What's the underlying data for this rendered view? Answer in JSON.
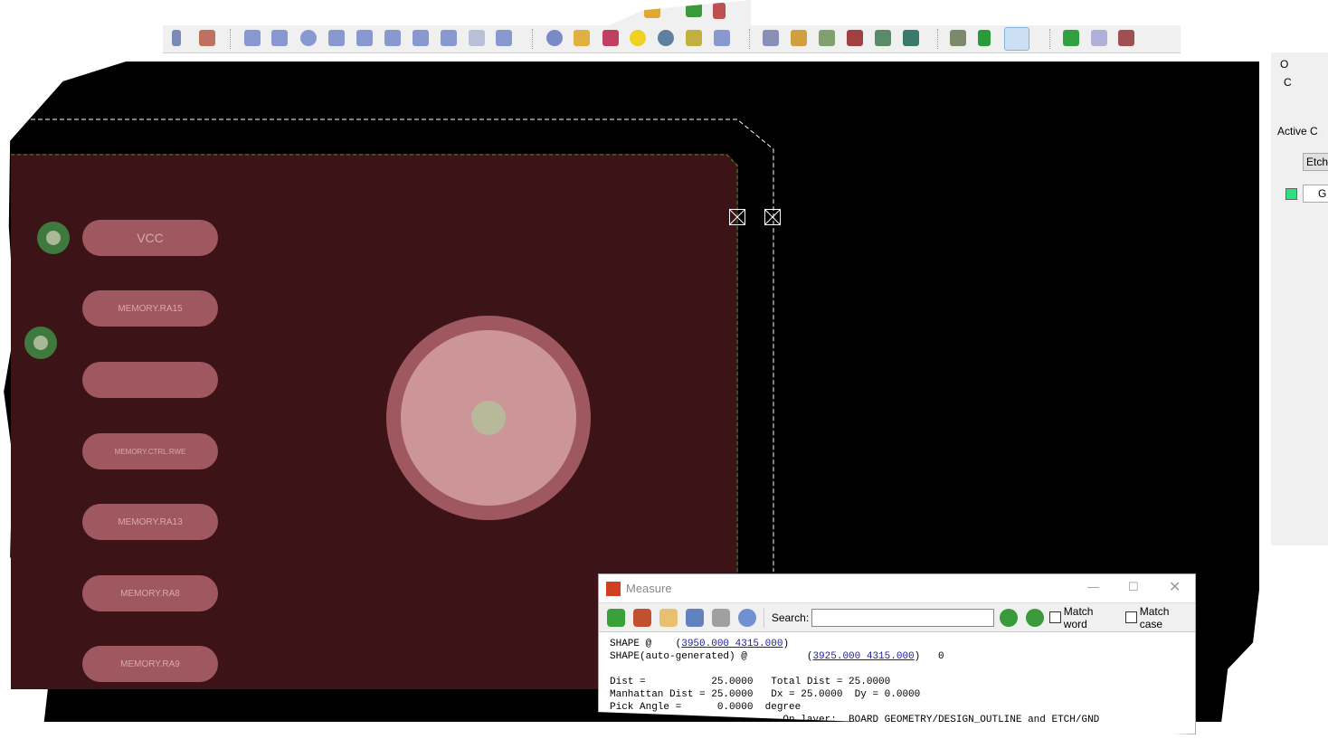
{
  "canvas": {
    "pads": [
      "VCC",
      "MEMORY.RA15",
      "",
      "MEMORY.CTRL.RWE",
      "MEMORY.RA13",
      "MEMORY.RA8",
      "MEMORY.RA9"
    ],
    "colors": {
      "background": "#000000",
      "board": "#3c1418",
      "pad": "#a05860",
      "via": "#3e7a3e",
      "outline": "#ffffff"
    }
  },
  "right_panel": {
    "tab1": "O",
    "tab2": "C",
    "active_label": "Active C",
    "class_value": "Etch",
    "subclass_value": "G"
  },
  "measure": {
    "title": "Measure",
    "search_label": "Search:",
    "search_value": "",
    "match_word": "Match word",
    "match_case": "Match case",
    "line1_prefix": "SHAPE @    (",
    "line1_link": "3950.000 4315.000",
    "line1_suffix": ")",
    "line2_prefix": "SHAPE(auto-generated) @          (",
    "line2_link": "3925.000 4315.000",
    "line2_suffix": ")   0",
    "line3": "Dist =           25.0000   Total Dist = 25.0000",
    "line4": "Manhattan Dist = 25.0000   Dx = 25.0000  Dy = 0.0000",
    "line5": "Pick Angle =      0.0000  degree",
    "line6": "                             On layer:  BOARD GEOMETRY/DESIGN_OUTLINE and ETCH/GND"
  }
}
